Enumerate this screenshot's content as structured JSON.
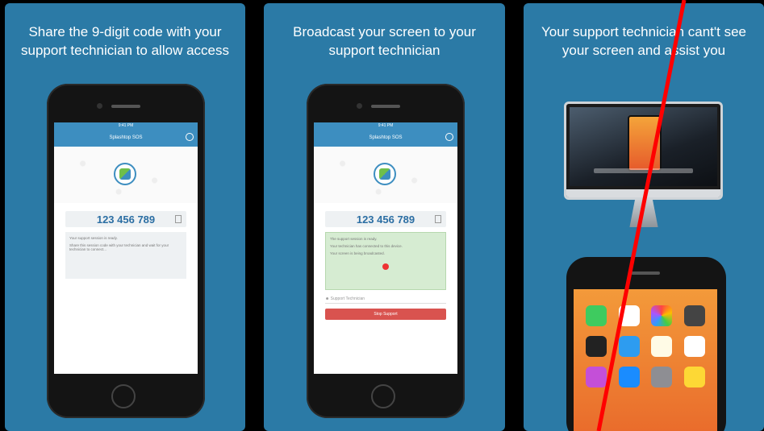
{
  "panels": [
    {
      "caption": "Share the 9-digit code with your support technician to allow access",
      "phone": {
        "status_time": "9:41 PM",
        "app_title": "Splashtop SOS",
        "code": "123 456 789",
        "info_lines": [
          "Your support session is ready.",
          "Share this session code with your technician and wait for your technician to connect..."
        ]
      }
    },
    {
      "caption": "Broadcast your screen to your support technician",
      "phone": {
        "status_time": "9:41 PM",
        "app_title": "Splashtop SOS",
        "code": "123 456 789",
        "info_lines": [
          "The support session is ready.",
          "Your technician has connected to this device.",
          "Your screen is being broadcasted."
        ],
        "technician_placeholder": "Support Technician",
        "button_label": "Stop Support"
      }
    },
    {
      "caption": "Your support technician cant't see your screen and assist you"
    }
  ],
  "colors": {
    "panel_bg": "#2b7aa6",
    "app_bar": "#3d8ec0",
    "code_text": "#2b6ea3",
    "stop_button": "#d9534f",
    "red_slash": "#ff0000"
  },
  "icons": [
    "gear-icon",
    "copy-icon",
    "splashtop-logo-icon",
    "record-dot-icon",
    "user-icon"
  ]
}
